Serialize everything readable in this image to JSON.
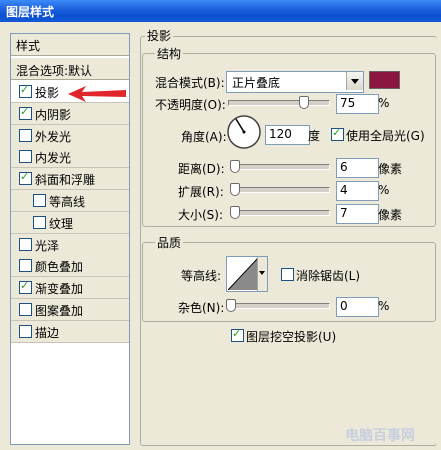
{
  "window": {
    "title": "图层样式"
  },
  "sidebar": {
    "header": "样式",
    "blend_options": "混合选项:默认",
    "items": [
      {
        "label": "投影",
        "checked": true,
        "selected": true
      },
      {
        "label": "内阴影",
        "checked": true
      },
      {
        "label": "外发光",
        "checked": false
      },
      {
        "label": "内发光",
        "checked": false
      },
      {
        "label": "斜面和浮雕",
        "checked": true
      },
      {
        "label": "等高线",
        "checked": false,
        "sub": true
      },
      {
        "label": "纹理",
        "checked": false,
        "sub": true
      },
      {
        "label": "光泽",
        "checked": false
      },
      {
        "label": "颜色叠加",
        "checked": false
      },
      {
        "label": "渐变叠加",
        "checked": true
      },
      {
        "label": "图案叠加",
        "checked": false
      },
      {
        "label": "描边",
        "checked": false
      }
    ]
  },
  "drop_shadow": {
    "title": "投影",
    "structure": {
      "title": "结构",
      "blend_mode_label": "混合模式(B):",
      "blend_mode_value": "正片叠底",
      "shadow_color": "#8b1741",
      "opacity_label": "不透明度(O):",
      "opacity_value": "75",
      "opacity_fraction": 0.75,
      "opacity_unit": "%",
      "angle_label": "角度(A):",
      "angle_value": "120",
      "angle_unit": "度",
      "global_light_label": "使用全局光(G)",
      "global_light_checked": true,
      "distance_label": "距离(D):",
      "distance_value": "6",
      "distance_unit": "像素",
      "spread_label": "扩展(R):",
      "spread_value": "4",
      "spread_unit": "%",
      "size_label": "大小(S):",
      "size_value": "7",
      "size_unit": "像素"
    },
    "quality": {
      "title": "品质",
      "contour_label": "等高线:",
      "antialias_label": "消除锯齿(L)",
      "antialias_checked": false,
      "noise_label": "杂色(N):",
      "noise_value": "0",
      "noise_unit": "%"
    },
    "knockout_label": "图层挖空投影(U)",
    "knockout_checked": true
  },
  "watermark": "电脑百事网"
}
